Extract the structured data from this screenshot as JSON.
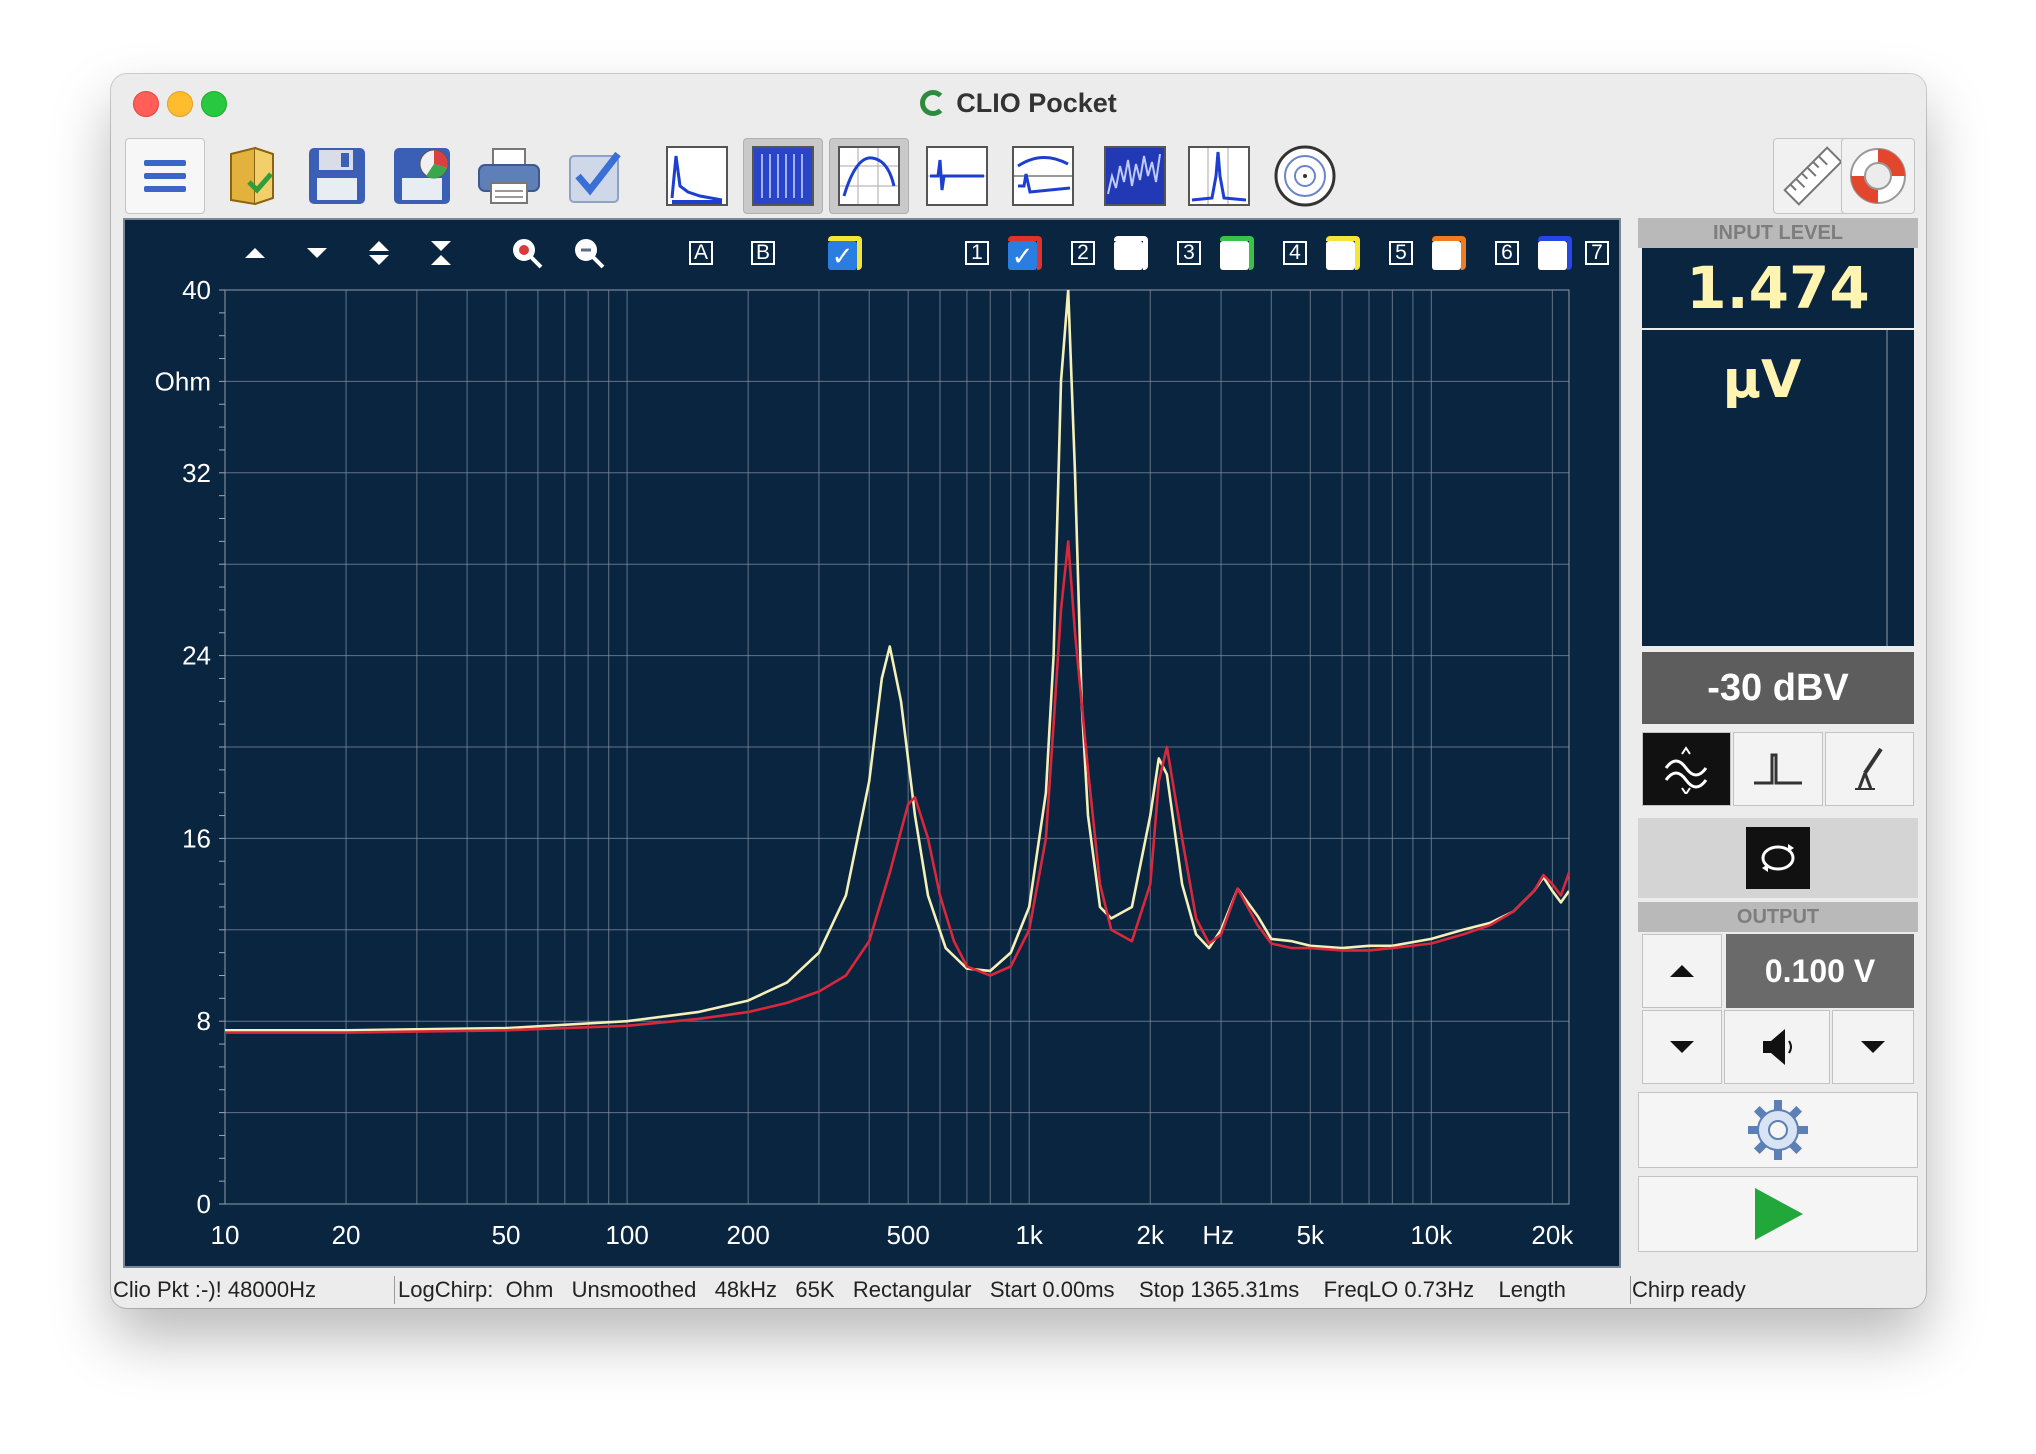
{
  "window": {
    "title": "CLIO Pocket"
  },
  "plot_toolbar": {
    "cursor_labels": [
      "A",
      "B"
    ],
    "curve_numbers": [
      "1",
      "2",
      "3",
      "4",
      "5",
      "6",
      "7"
    ],
    "curve_colors": [
      "#e0312b",
      "#ffffff",
      "#38c24a",
      "#f4e53a",
      "#ef7b22",
      "#2746e6"
    ]
  },
  "input_level": {
    "header": "INPUT LEVEL",
    "value": "1.474",
    "unit": "µV",
    "range": "-30 dBV"
  },
  "output": {
    "header": "OUTPUT",
    "value": "0.100 V"
  },
  "statusbar": {
    "device": "Clio Pkt :-)! 48000Hz",
    "settings": "LogChirp:  Ohm   Unsmoothed   48kHz   65K   Rectangular   Start 0.00ms    Stop 1365.31ms    FreqLO 0.73Hz    Length",
    "state": "Chirp ready"
  },
  "chart_data": {
    "type": "line",
    "ylabel": "Ohm",
    "xlabel": "Hz",
    "x_scale": "log",
    "xlim": [
      10,
      22000
    ],
    "ylim": [
      0,
      40
    ],
    "yticks": [
      0,
      8,
      16,
      24,
      32,
      40
    ],
    "xtick_labels": [
      {
        "x": 10,
        "label": "10"
      },
      {
        "x": 20,
        "label": "20"
      },
      {
        "x": 50,
        "label": "50"
      },
      {
        "x": 100,
        "label": "100"
      },
      {
        "x": 200,
        "label": "200"
      },
      {
        "x": 500,
        "label": "500"
      },
      {
        "x": 1000,
        "label": "1k"
      },
      {
        "x": 2000,
        "label": "2k"
      },
      {
        "x": 5000,
        "label": "5k"
      },
      {
        "x": 10000,
        "label": "10k"
      },
      {
        "x": 20000,
        "label": "20k"
      }
    ],
    "grid": true,
    "series": [
      {
        "color": "#f4f0b8",
        "x": [
          10,
          20,
          50,
          100,
          150,
          200,
          250,
          300,
          350,
          400,
          430,
          450,
          480,
          520,
          560,
          620,
          700,
          800,
          900,
          1000,
          1100,
          1150,
          1200,
          1250,
          1300,
          1350,
          1400,
          1500,
          1600,
          1800,
          2000,
          2100,
          2200,
          2400,
          2600,
          2800,
          3000,
          3300,
          3700,
          4000,
          4500,
          5000,
          6000,
          7000,
          8000,
          10000,
          12000,
          14000,
          16000,
          18000,
          19000,
          20000,
          21000,
          22000
        ],
        "y": [
          7.6,
          7.6,
          7.7,
          8.0,
          8.4,
          8.9,
          9.7,
          11.0,
          13.5,
          18.5,
          23.0,
          24.4,
          22.0,
          17.0,
          13.5,
          11.2,
          10.3,
          10.2,
          11.0,
          13.0,
          18.0,
          24.0,
          36.0,
          40.0,
          32.0,
          22.0,
          17.0,
          13.0,
          12.5,
          13.0,
          17.0,
          19.5,
          18.8,
          14.0,
          11.8,
          11.2,
          12.0,
          13.8,
          12.6,
          11.6,
          11.5,
          11.3,
          11.2,
          11.3,
          11.3,
          11.6,
          12.0,
          12.3,
          12.8,
          13.7,
          14.3,
          13.7,
          13.2,
          13.7
        ]
      },
      {
        "color": "#d9273c",
        "x": [
          10,
          20,
          50,
          100,
          150,
          200,
          250,
          300,
          350,
          400,
          450,
          500,
          520,
          560,
          600,
          650,
          700,
          800,
          900,
          1000,
          1100,
          1150,
          1200,
          1250,
          1300,
          1400,
          1500,
          1600,
          1800,
          2000,
          2100,
          2200,
          2400,
          2600,
          2800,
          3000,
          3300,
          3700,
          4000,
          4500,
          5000,
          6000,
          7000,
          8000,
          10000,
          12000,
          14000,
          16000,
          18000,
          19000,
          20000,
          21000,
          22000
        ],
        "y": [
          7.5,
          7.5,
          7.6,
          7.8,
          8.1,
          8.4,
          8.8,
          9.3,
          10.0,
          11.5,
          14.5,
          17.5,
          17.8,
          16.0,
          13.5,
          11.5,
          10.4,
          10.0,
          10.4,
          12.0,
          16.0,
          21.0,
          26.0,
          29.0,
          25.0,
          19.0,
          14.0,
          12.0,
          11.5,
          14.0,
          18.5,
          20.0,
          16.0,
          12.5,
          11.4,
          11.8,
          13.8,
          12.2,
          11.4,
          11.2,
          11.2,
          11.1,
          11.1,
          11.2,
          11.4,
          11.8,
          12.2,
          12.8,
          13.7,
          14.4,
          14.0,
          13.5,
          14.5
        ]
      }
    ]
  }
}
